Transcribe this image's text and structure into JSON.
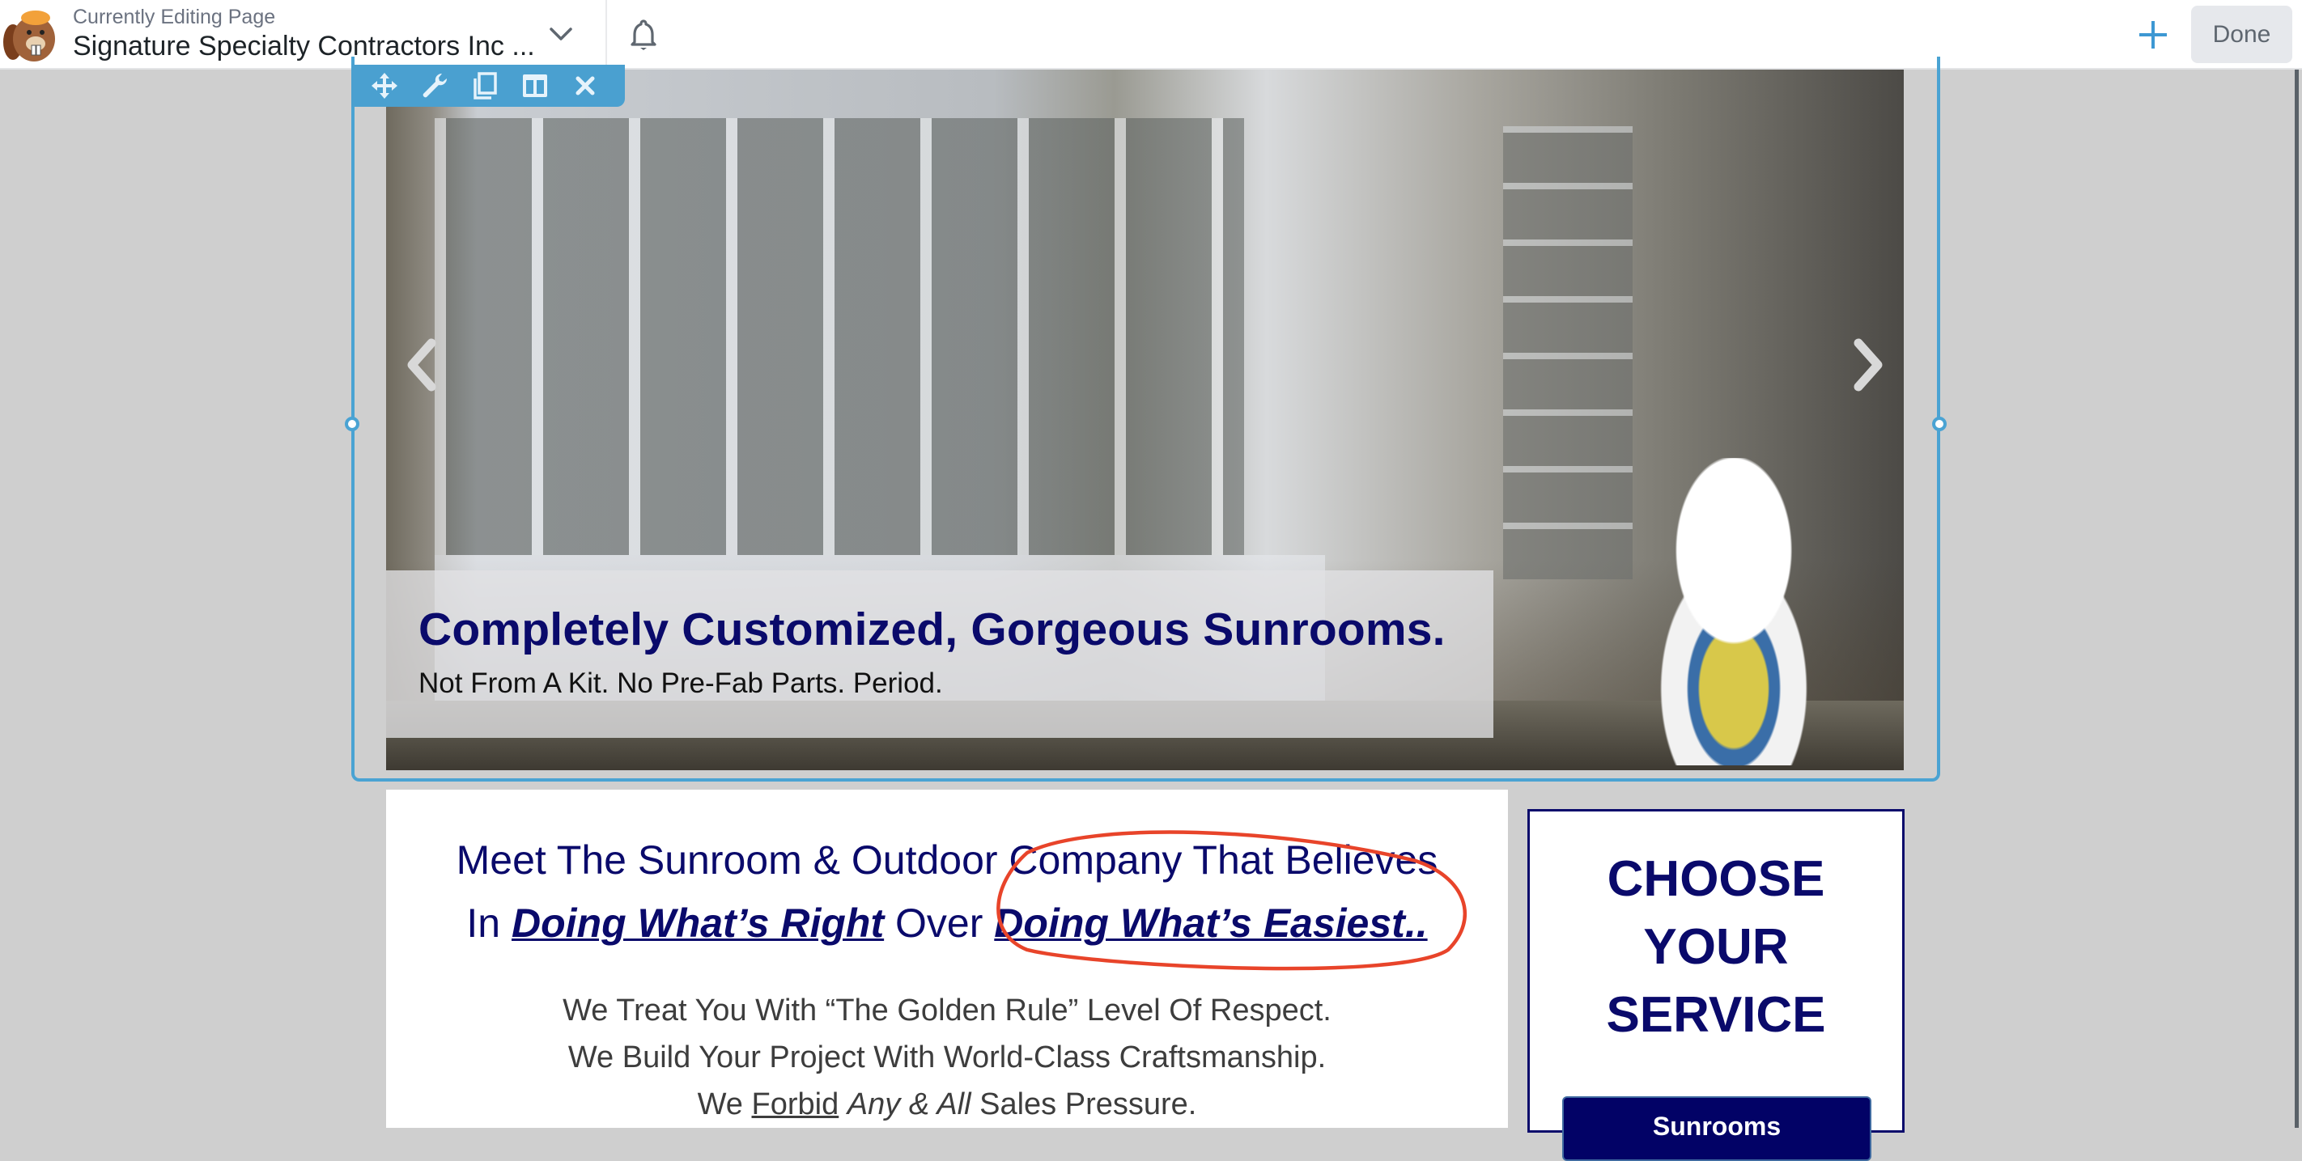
{
  "header": {
    "label": "Currently Editing Page",
    "page_title": "Signature Specialty Contractors Inc ...",
    "done_label": "Done",
    "icons": {
      "logo": "beaver-builder-logo",
      "dropdown": "chevron-down-icon",
      "notifications": "bell-icon",
      "add": "plus-icon"
    }
  },
  "module_toolbar": {
    "icons": [
      "move-icon",
      "wrench-icon",
      "duplicate-icon",
      "columns-icon",
      "close-icon"
    ]
  },
  "slider": {
    "caption_title": "Completely Customized, Gorgeous Sunrooms.",
    "caption_subtitle": "Not From A Kit. No Pre-Fab Parts. Period.",
    "prev_icon": "chevron-left-icon",
    "next_icon": "chevron-right-icon"
  },
  "content": {
    "headline_line1": "Meet The Sunroom & Outdoor Company That Believes",
    "headline_in": "In",
    "headline_em1": "Doing What’s Right",
    "headline_over": "Over",
    "headline_em2": "Doing What’s Easiest..",
    "promise1": "We Treat You With “The Golden Rule” Level Of Respect.",
    "promise2": "We Build Your Project With World-Class Craftsmanship.",
    "promise3_we": "We",
    "promise3_forbid": "Forbid",
    "promise3_anyall": "Any & All",
    "promise3_rest": "Sales Pressure."
  },
  "sidebar": {
    "title_line1": "CHOOSE",
    "title_line2": "YOUR",
    "title_line3": "SERVICE",
    "button_label": "Sunrooms"
  },
  "colors": {
    "brand_navy": "#0a0a6b",
    "editor_blue": "#4aa3d3",
    "annotation_red": "#e8442a",
    "canvas_gray": "#cfcfcf"
  }
}
